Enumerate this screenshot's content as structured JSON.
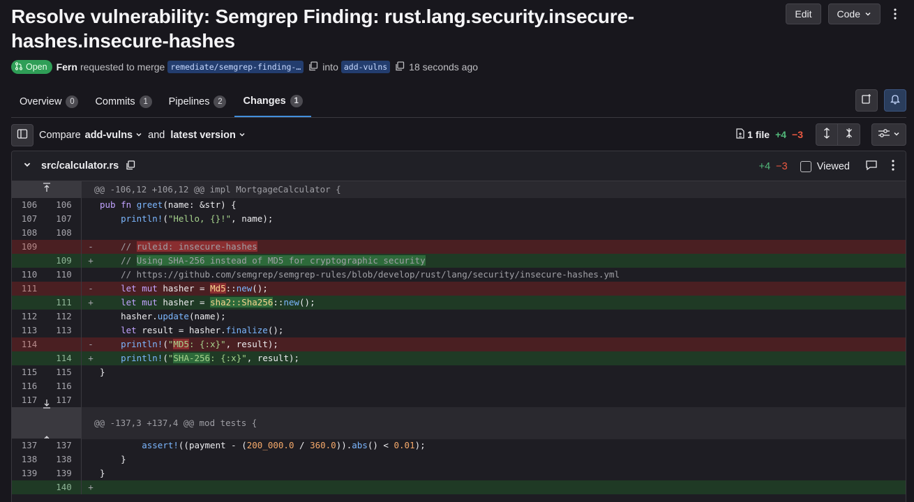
{
  "mr": {
    "title": "Resolve vulnerability: Semgrep Finding: rust.lang.security.insecure-hashes.insecure-hashes",
    "status": "Open",
    "author": "Fern",
    "requested_text": "requested to merge",
    "source_branch": "remediate/semgrep-finding-…",
    "into_text": "into",
    "target_branch": "add-vulns",
    "time": "18 seconds ago"
  },
  "actions": {
    "edit": "Edit",
    "code": "Code"
  },
  "tabs": [
    {
      "label": "Overview",
      "count": "0"
    },
    {
      "label": "Commits",
      "count": "1"
    },
    {
      "label": "Pipelines",
      "count": "2"
    },
    {
      "label": "Changes",
      "count": "1"
    }
  ],
  "compare": {
    "prefix": "Compare",
    "base": "add-vulns",
    "and": "and",
    "head": "latest version",
    "files": "1 file",
    "added": "+4",
    "removed": "−3"
  },
  "file": {
    "name": "src/calculator.rs",
    "added": "+4",
    "removed": "−3",
    "viewed_label": "Viewed"
  },
  "hunks": [
    "@@ -106,12 +106,12 @@ impl MortgageCalculator {",
    "@@ -137,3 +137,4 @@ mod tests {"
  ],
  "lines": [
    {
      "old": "106",
      "new": "106",
      "sign": "",
      "code": "pub fn greet(name: &str) {"
    },
    {
      "old": "107",
      "new": "107",
      "sign": "",
      "code": "    println!(\"Hello, {}!\", name);"
    },
    {
      "old": "108",
      "new": "108",
      "sign": "",
      "code": ""
    },
    {
      "old": "109",
      "new": "",
      "sign": "-",
      "code": "    // ruleid: insecure-hashes"
    },
    {
      "old": "",
      "new": "109",
      "sign": "+",
      "code": "    // Using SHA-256 instead of MD5 for cryptographic security"
    },
    {
      "old": "110",
      "new": "110",
      "sign": "",
      "code": "    // https://github.com/semgrep/semgrep-rules/blob/develop/rust/lang/security/insecure-hashes.yml"
    },
    {
      "old": "111",
      "new": "",
      "sign": "-",
      "code": "    let mut hasher = Md5::new();"
    },
    {
      "old": "",
      "new": "111",
      "sign": "+",
      "code": "    let mut hasher = sha2::Sha256::new();"
    },
    {
      "old": "112",
      "new": "112",
      "sign": "",
      "code": "    hasher.update(name);"
    },
    {
      "old": "113",
      "new": "113",
      "sign": "",
      "code": "    let result = hasher.finalize();"
    },
    {
      "old": "114",
      "new": "",
      "sign": "-",
      "code": "    println!(\"MD5: {:x}\", result);"
    },
    {
      "old": "",
      "new": "114",
      "sign": "+",
      "code": "    println!(\"SHA-256: {:x}\", result);"
    },
    {
      "old": "115",
      "new": "115",
      "sign": "",
      "code": "}"
    },
    {
      "old": "116",
      "new": "116",
      "sign": "",
      "code": ""
    },
    {
      "old": "117",
      "new": "117",
      "sign": "",
      "code": ""
    },
    {
      "old": "137",
      "new": "137",
      "sign": "",
      "code": "        assert!((payment - (200_000.0 / 360.0)).abs() < 0.01);"
    },
    {
      "old": "138",
      "new": "138",
      "sign": "",
      "code": "    }"
    },
    {
      "old": "139",
      "new": "139",
      "sign": "",
      "code": "}"
    },
    {
      "old": "",
      "new": "140",
      "sign": "+",
      "code": ""
    }
  ]
}
